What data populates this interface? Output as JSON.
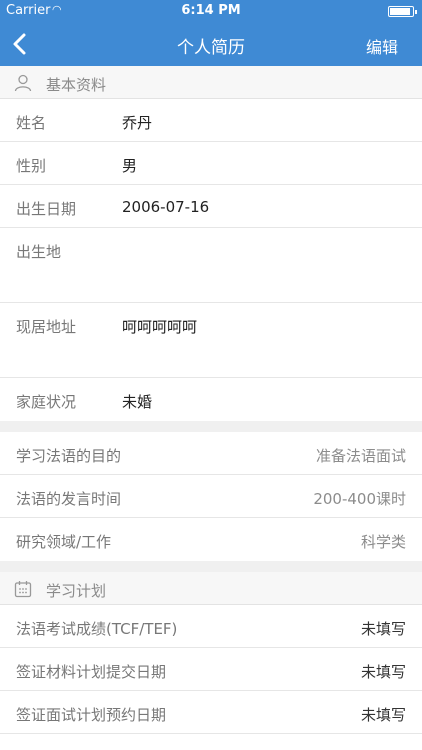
{
  "status_bar": {
    "carrier": "Carrier",
    "time": "6:14 PM"
  },
  "nav": {
    "title": "个人简历",
    "edit": "编辑"
  },
  "basic": {
    "header": "基本资料",
    "rows": [
      {
        "label": "姓名",
        "value": "乔丹"
      },
      {
        "label": "性别",
        "value": "男"
      },
      {
        "label": "出生日期",
        "value": "2006-07-16"
      },
      {
        "label": "出生地",
        "value": ""
      },
      {
        "label": "现居地址",
        "value": "呵呵呵呵呵"
      },
      {
        "label": "家庭状况",
        "value": "未婚"
      }
    ]
  },
  "study": {
    "rows": [
      {
        "label": "学习法语的目的",
        "value": "准备法语面试"
      },
      {
        "label": "法语的发言时间",
        "value": "200-400课时"
      },
      {
        "label": "研究领域/工作",
        "value": "科学类"
      }
    ]
  },
  "plan": {
    "header": "学习计划",
    "rows": [
      {
        "label": "法语考试成绩(TCF/TEF)",
        "value": "未填写"
      },
      {
        "label": "签证材料计划提交日期",
        "value": "未填写"
      },
      {
        "label": "签证面试计划预约日期",
        "value": "未填写"
      }
    ]
  }
}
